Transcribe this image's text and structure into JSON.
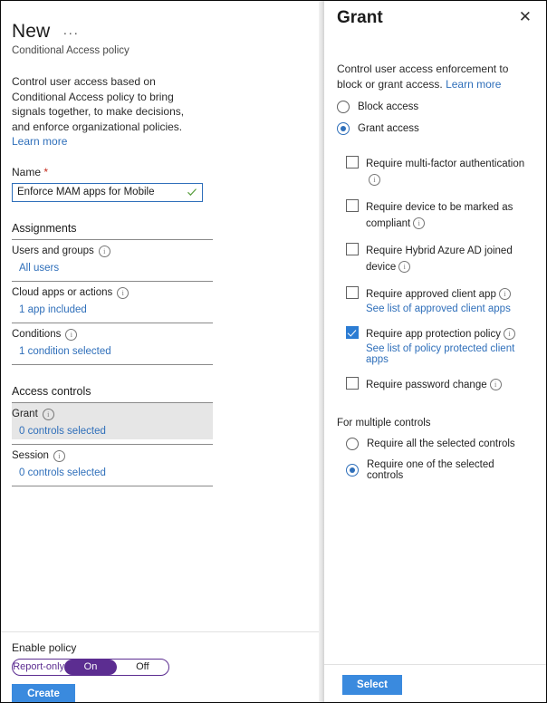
{
  "left_blade": {
    "title": "New",
    "overflow_menu": "···",
    "subtitle": "Conditional Access policy",
    "intro_text": "Control user access based on Conditional Access policy to bring signals together, to make decisions, and enforce organizational policies.",
    "intro_link": "Learn more",
    "name_label": "Name",
    "name_required_mark": "*",
    "name_value": "Enforce MAM apps for Mobile",
    "name_placeholder": "",
    "sections": [
      {
        "heading": "Assignments",
        "rows": [
          {
            "name": "Users and groups",
            "value": "All users",
            "highlighted": false
          },
          {
            "name": "Cloud apps or actions",
            "value": "1 app included",
            "highlighted": false
          },
          {
            "name": "Conditions",
            "value": "1 condition selected",
            "highlighted": false
          }
        ]
      },
      {
        "heading": "Access controls",
        "rows": [
          {
            "name": "Grant",
            "value": "0 controls selected",
            "highlighted": true
          },
          {
            "name": "Session",
            "value": "0 controls selected",
            "highlighted": false
          }
        ]
      }
    ],
    "footer": {
      "enable_label": "Enable policy",
      "toggle_options": [
        "Report-only",
        "On",
        "Off"
      ],
      "toggle_selected": "On",
      "create_label": "Create"
    }
  },
  "right_panel": {
    "title": "Grant",
    "close_icon": "✕",
    "description": "Control user access enforcement to block or grant access.",
    "description_link": "Learn more",
    "access_mode_options": [
      {
        "label": "Block access",
        "selected": false
      },
      {
        "label": "Grant access",
        "selected": true
      }
    ],
    "controls": [
      {
        "label": "Require multi-factor authentication",
        "checked": false,
        "sublink": ""
      },
      {
        "label": "Require device to be marked as compliant",
        "checked": false,
        "sublink": ""
      },
      {
        "label": "Require Hybrid Azure AD joined device",
        "checked": false,
        "sublink": ""
      },
      {
        "label": "Require approved client app",
        "checked": false,
        "sublink": "See list of approved client apps"
      },
      {
        "label": "Require app protection policy",
        "checked": true,
        "sublink": "See list of policy protected client apps"
      },
      {
        "label": "Require password change",
        "checked": false,
        "sublink": ""
      }
    ],
    "multiple_controls_heading": "For multiple controls",
    "multiple_controls_options": [
      {
        "label": "Require all the selected controls",
        "selected": false
      },
      {
        "label": "Require one of the selected controls",
        "selected": true
      }
    ],
    "footer": {
      "select_label": "Select"
    }
  },
  "colors": {
    "accent_blue": "#2f6fba",
    "button_blue": "#3a8ade",
    "checkbox_blue": "#2b7cd3",
    "toggle_purple": "#5c2d91",
    "valid_green": "#5a9e3f",
    "required_red": "#c42b1c",
    "highlight_gray": "#e6e6e6"
  }
}
